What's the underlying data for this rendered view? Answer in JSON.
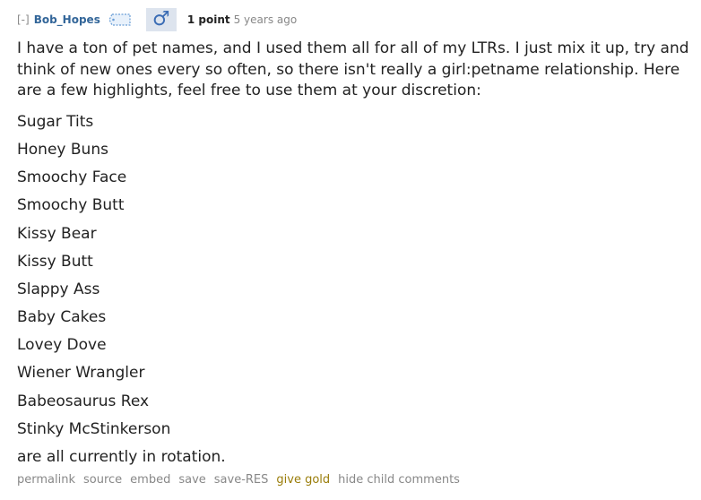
{
  "comment": {
    "collapse": "[-]",
    "author": "Bob_Hopes",
    "flair_symbol": "♂",
    "score": "1 point",
    "time": "5 years ago",
    "intro": "I have a ton of pet names, and I used them all for all of my LTRs. I just mix it up, try and think of new ones every so often, so there isn't really a girl:petname relationship. Here are a few highlights, feel free to use them at your discretion:",
    "pet_names": [
      "Sugar Tits",
      "Honey Buns",
      "Smoochy Face",
      "Smoochy Butt",
      "Kissy Bear",
      "Kissy Butt",
      "Slappy Ass",
      "Baby Cakes",
      "Lovey Dove",
      "Wiener Wrangler",
      "Babeosaurus Rex",
      "Stinky McStinkerson"
    ],
    "outro": "are all currently in rotation."
  },
  "buttons": {
    "permalink": "permalink",
    "source": "source",
    "embed": "embed",
    "save": "save",
    "save_res": "save-RES",
    "give_gold": "give gold",
    "hide_child": "hide child comments"
  },
  "colors": {
    "author": "#336699",
    "gold": "#9a7d0a",
    "flair_bg": "#dde4ee",
    "muted": "#888888"
  }
}
